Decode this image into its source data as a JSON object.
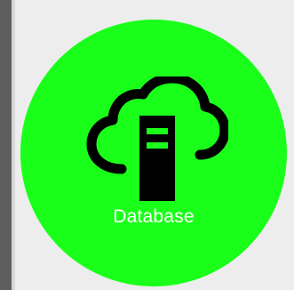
{
  "tile": {
    "label": "Database",
    "icon": "cloud-server-icon",
    "background_color": "#1aff1a",
    "label_color": "#ffffff",
    "icon_color": "#000000"
  },
  "frame": {
    "background_color": "#ededed",
    "left_bar_color": "#5e5e5e"
  }
}
